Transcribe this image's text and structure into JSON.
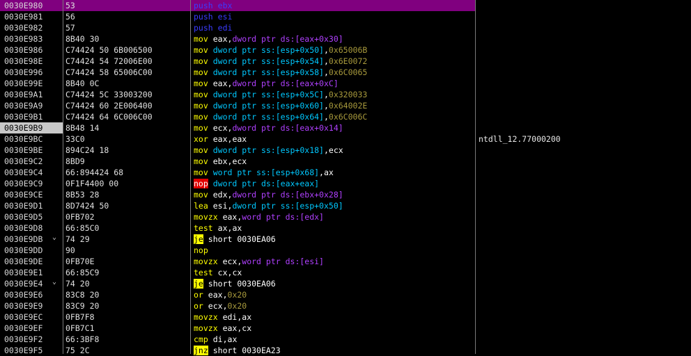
{
  "colors": {
    "selection": "#80007f",
    "current_addr_bg": "#c8c8c8",
    "mnemonic": "#ffff00",
    "push": "#3b3bff",
    "memory": "#b040ff",
    "operand_size": "#00c8ff",
    "immediate": "#a89a3c",
    "jump_highlight": "#ffff00",
    "nop_highlight": "#e00000"
  },
  "rows": [
    {
      "addr": "0030E980",
      "hex": "53",
      "mn": "push",
      "ops": [
        [
          "pushreg",
          "ebx"
        ]
      ],
      "sel": true
    },
    {
      "addr": "0030E981",
      "hex": "56",
      "mn": "push",
      "ops": [
        [
          "pushreg",
          "esi"
        ]
      ]
    },
    {
      "addr": "0030E982",
      "hex": "57",
      "mn": "push",
      "ops": [
        [
          "pushreg",
          "edi"
        ]
      ]
    },
    {
      "addr": "0030E983",
      "hex": "8B40 30",
      "mn": "mov",
      "ops": [
        [
          "reg",
          "eax"
        ],
        [
          "plain",
          ","
        ],
        [
          "mem",
          "dword ptr ds:[eax+0x30]"
        ]
      ]
    },
    {
      "addr": "0030E986",
      "hex": "C74424 50 6B006500",
      "mn": "mov",
      "ops": [
        [
          "sz",
          "dword ptr ss:[esp+0x50]"
        ],
        [
          "plain",
          ","
        ],
        [
          "imm",
          "0x65006B"
        ]
      ]
    },
    {
      "addr": "0030E98E",
      "hex": "C74424 54 72006E00",
      "mn": "mov",
      "ops": [
        [
          "sz",
          "dword ptr ss:[esp+0x54]"
        ],
        [
          "plain",
          ","
        ],
        [
          "imm",
          "0x6E0072"
        ]
      ]
    },
    {
      "addr": "0030E996",
      "hex": "C74424 58 65006C00",
      "mn": "mov",
      "ops": [
        [
          "sz",
          "dword ptr ss:[esp+0x58]"
        ],
        [
          "plain",
          ","
        ],
        [
          "imm",
          "0x6C0065"
        ]
      ]
    },
    {
      "addr": "0030E99E",
      "hex": "8B40 0C",
      "mn": "mov",
      "ops": [
        [
          "reg",
          "eax"
        ],
        [
          "plain",
          ","
        ],
        [
          "mem",
          "dword ptr ds:[eax+0xC]"
        ]
      ]
    },
    {
      "addr": "0030E9A1",
      "hex": "C74424 5C 33003200",
      "mn": "mov",
      "ops": [
        [
          "sz",
          "dword ptr ss:[esp+0x5C]"
        ],
        [
          "plain",
          ","
        ],
        [
          "imm",
          "0x320033"
        ]
      ]
    },
    {
      "addr": "0030E9A9",
      "hex": "C74424 60 2E006400",
      "mn": "mov",
      "ops": [
        [
          "sz",
          "dword ptr ss:[esp+0x60]"
        ],
        [
          "plain",
          ","
        ],
        [
          "imm",
          "0x64002E"
        ]
      ]
    },
    {
      "addr": "0030E9B1",
      "hex": "C74424 64 6C006C00",
      "mn": "mov",
      "ops": [
        [
          "sz",
          "dword ptr ss:[esp+0x64]"
        ],
        [
          "plain",
          ","
        ],
        [
          "imm",
          "0x6C006C"
        ]
      ]
    },
    {
      "addr": "0030E9B9",
      "hex": "8B48 14",
      "mn": "mov",
      "ops": [
        [
          "reg",
          "ecx"
        ],
        [
          "plain",
          ","
        ],
        [
          "mem",
          "dword ptr ds:[eax+0x14]"
        ]
      ],
      "cur": true
    },
    {
      "addr": "0030E9BC",
      "hex": "33C0",
      "mn": "xor",
      "ops": [
        [
          "reg",
          "eax"
        ],
        [
          "plain",
          ","
        ],
        [
          "reg",
          "eax"
        ]
      ],
      "cmt": "ntdll_12.77000200"
    },
    {
      "addr": "0030E9BE",
      "hex": "894C24 18",
      "mn": "mov",
      "ops": [
        [
          "sz",
          "dword ptr ss:[esp+0x18]"
        ],
        [
          "plain",
          ","
        ],
        [
          "reg",
          "ecx"
        ]
      ]
    },
    {
      "addr": "0030E9C2",
      "hex": "8BD9",
      "mn": "mov",
      "ops": [
        [
          "reg",
          "ebx"
        ],
        [
          "plain",
          ","
        ],
        [
          "reg",
          "ecx"
        ]
      ]
    },
    {
      "addr": "0030E9C4",
      "hex": "66:894424 68",
      "mn": "mov",
      "ops": [
        [
          "sz",
          "word ptr ss:[esp+0x68]"
        ],
        [
          "plain",
          ","
        ],
        [
          "reg",
          "ax"
        ]
      ]
    },
    {
      "addr": "0030E9C9",
      "hex": "0F1F4400 00",
      "mn": "nop",
      "mnstyle": "nopred",
      "ops": [
        [
          "sz",
          "dword ptr ds:[eax+eax]"
        ]
      ]
    },
    {
      "addr": "0030E9CE",
      "hex": "8B53 28",
      "mn": "mov",
      "ops": [
        [
          "reg",
          "edx"
        ],
        [
          "plain",
          ","
        ],
        [
          "mem",
          "dword ptr ds:[ebx+0x28]"
        ]
      ]
    },
    {
      "addr": "0030E9D1",
      "hex": "8D7424 50",
      "mn": "lea",
      "ops": [
        [
          "reg",
          "esi"
        ],
        [
          "plain",
          ","
        ],
        [
          "sz",
          "dword ptr ss:[esp+0x50]"
        ]
      ]
    },
    {
      "addr": "0030E9D5",
      "hex": "0FB702",
      "mn": "movzx",
      "ops": [
        [
          "reg",
          "eax"
        ],
        [
          "plain",
          ","
        ],
        [
          "mem",
          "word ptr ds:[edx]"
        ]
      ]
    },
    {
      "addr": "0030E9D8",
      "hex": "66:85C0",
      "mn": "test",
      "ops": [
        [
          "reg",
          "ax"
        ],
        [
          "plain",
          ","
        ],
        [
          "reg",
          "ax"
        ]
      ]
    },
    {
      "addr": "0030E9DB",
      "hex": "74 29",
      "mn": "je",
      "mnstyle": "jcc",
      "ops": [
        [
          "plain",
          "short 0030EA06"
        ]
      ],
      "jmp": "⌄"
    },
    {
      "addr": "0030E9DD",
      "hex": "90",
      "mn": "nop",
      "ops": []
    },
    {
      "addr": "0030E9DE",
      "hex": "0FB70E",
      "mn": "movzx",
      "ops": [
        [
          "reg",
          "ecx"
        ],
        [
          "plain",
          ","
        ],
        [
          "mem",
          "word ptr ds:[esi]"
        ]
      ]
    },
    {
      "addr": "0030E9E1",
      "hex": "66:85C9",
      "mn": "test",
      "ops": [
        [
          "reg",
          "cx"
        ],
        [
          "plain",
          ","
        ],
        [
          "reg",
          "cx"
        ]
      ]
    },
    {
      "addr": "0030E9E4",
      "hex": "74 20",
      "mn": "je",
      "mnstyle": "jcc",
      "ops": [
        [
          "plain",
          "short 0030EA06"
        ]
      ],
      "jmp": "⌄"
    },
    {
      "addr": "0030E9E6",
      "hex": "83C8 20",
      "mn": "or",
      "ops": [
        [
          "reg",
          "eax"
        ],
        [
          "plain",
          ","
        ],
        [
          "imm",
          "0x20"
        ]
      ]
    },
    {
      "addr": "0030E9E9",
      "hex": "83C9 20",
      "mn": "or",
      "ops": [
        [
          "reg",
          "ecx"
        ],
        [
          "plain",
          ","
        ],
        [
          "imm",
          "0x20"
        ]
      ]
    },
    {
      "addr": "0030E9EC",
      "hex": "0FB7F8",
      "mn": "movzx",
      "ops": [
        [
          "reg",
          "edi"
        ],
        [
          "plain",
          ","
        ],
        [
          "reg",
          "ax"
        ]
      ]
    },
    {
      "addr": "0030E9EF",
      "hex": "0FB7C1",
      "mn": "movzx",
      "ops": [
        [
          "reg",
          "eax"
        ],
        [
          "plain",
          ","
        ],
        [
          "reg",
          "cx"
        ]
      ]
    },
    {
      "addr": "0030E9F2",
      "hex": "66:3BF8",
      "mn": "cmp",
      "ops": [
        [
          "reg",
          "di"
        ],
        [
          "plain",
          ","
        ],
        [
          "reg",
          "ax"
        ]
      ]
    },
    {
      "addr": "0030E9F5",
      "hex": "75 2C",
      "mn": "jnz",
      "mnstyle": "jcc",
      "ops": [
        [
          "plain",
          "short 0030EA23"
        ]
      ]
    }
  ]
}
